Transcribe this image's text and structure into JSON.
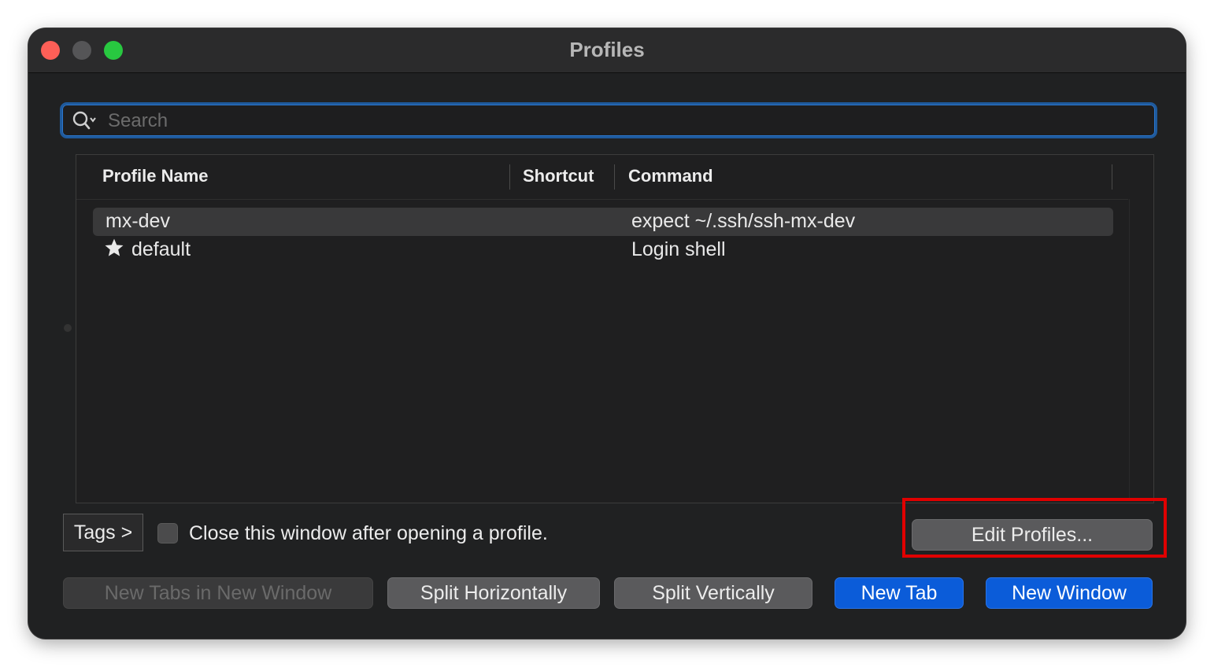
{
  "window": {
    "title": "Profiles"
  },
  "search": {
    "placeholder": "Search",
    "value": ""
  },
  "table": {
    "headers": {
      "name": "Profile Name",
      "shortcut": "Shortcut",
      "command": "Command"
    },
    "rows": [
      {
        "name": "mx-dev",
        "shortcut": "",
        "command": "expect ~/.ssh/ssh-mx-dev",
        "selected": true,
        "default": false
      },
      {
        "name": "default",
        "shortcut": "",
        "command": "Login shell",
        "selected": false,
        "default": true,
        "icon": "star-icon"
      }
    ]
  },
  "footer": {
    "tags_label": "Tags >",
    "close_checkbox_label": "Close this window after opening a profile.",
    "close_checkbox_checked": false,
    "edit_profiles_label": "Edit Profiles..."
  },
  "actions": {
    "new_tabs_in_new_window": "New Tabs in New Window",
    "split_horizontally": "Split Horizontally",
    "split_vertically": "Split Vertically",
    "new_tab": "New Tab",
    "new_window": "New Window"
  },
  "colors": {
    "window_bg": "#202122",
    "accent_blue": "#0b5cd9",
    "highlight_red": "#e00000"
  }
}
